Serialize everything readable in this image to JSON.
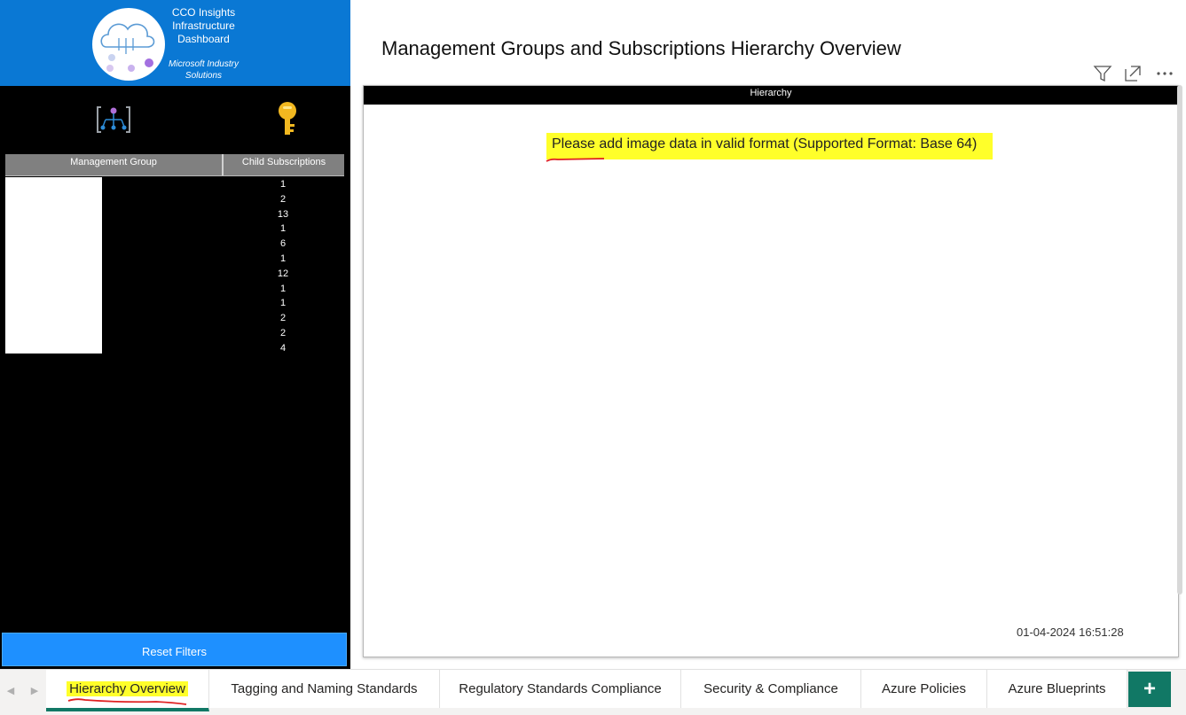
{
  "brand": {
    "title_lines": "CCO Insights Infrastructure Dashboard",
    "subtitle": "Microsoft Industry Solutions"
  },
  "page_title": "Management Groups and Subscriptions Hierarchy Overview",
  "table": {
    "headers": [
      "Management Group",
      "Child Subscriptions"
    ],
    "child_subscriptions": [
      "1",
      "2",
      "13",
      "1",
      "6",
      "1",
      "12",
      "1",
      "1",
      "2",
      "2",
      "4"
    ]
  },
  "reset_label": "Reset Filters",
  "visual": {
    "header": "Hierarchy",
    "message": "Please add image data in valid format (Supported Format: Base 64)",
    "timestamp": "01-04-2024 16:51:28"
  },
  "tabs": [
    "Hierarchy Overview",
    "Tagging and Naming Standards",
    "Regulatory Standards Compliance",
    "Security & Compliance",
    "Azure Policies",
    "Azure Blueprints"
  ],
  "colors": {
    "brand_blue": "#0a78d4",
    "reset_blue": "#1e90ff",
    "active_tab": "#117865",
    "highlight": "#ffff2a"
  },
  "icons": [
    "cloud-logo-icon",
    "management-group-icon",
    "key-icon",
    "filter-icon",
    "focus-mode-icon",
    "more-options-icon",
    "add-page-icon"
  ]
}
